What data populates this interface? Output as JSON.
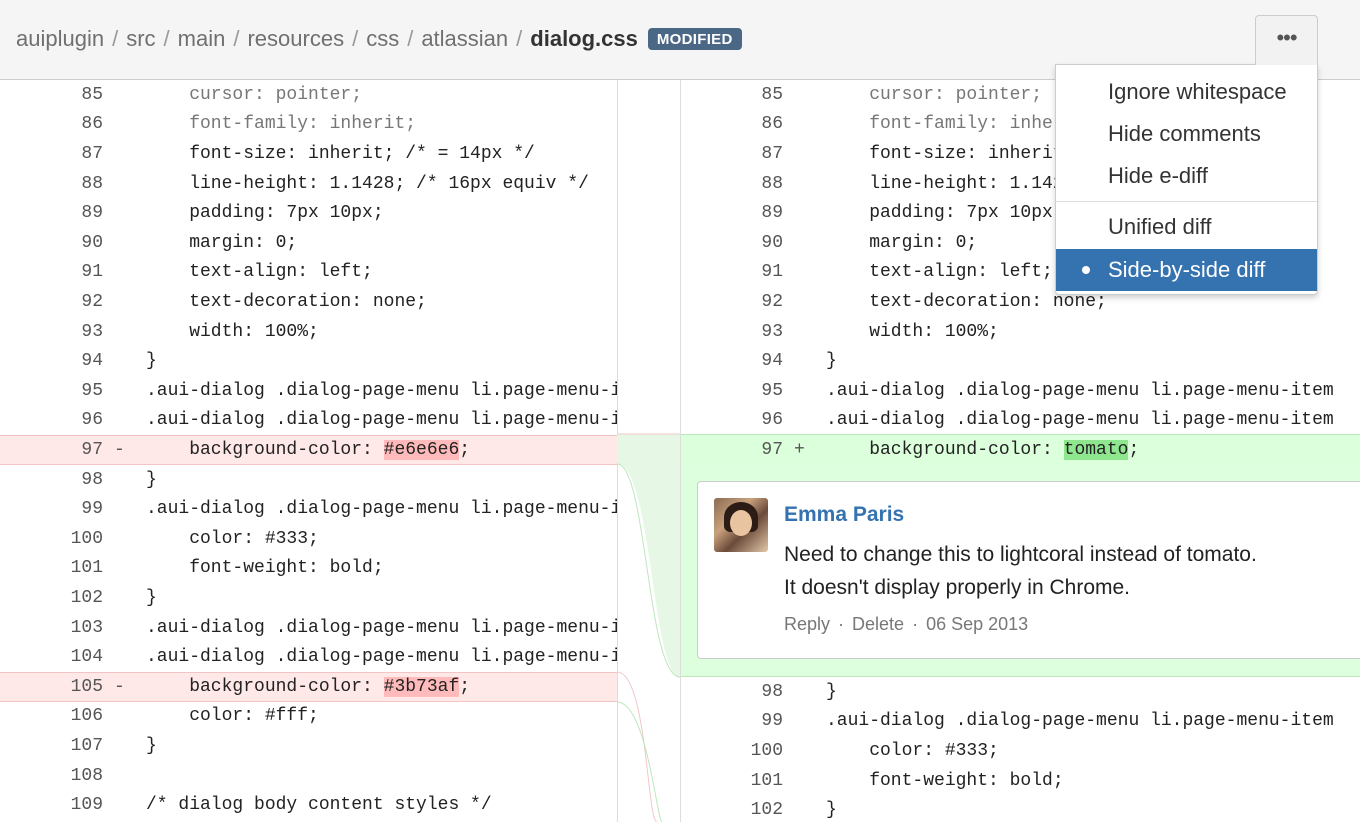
{
  "breadcrumb": {
    "parts": [
      "auiplugin",
      "src",
      "main",
      "resources",
      "css",
      "atlassian"
    ],
    "separator": "/",
    "file": "dialog.css",
    "badge": "MODIFIED"
  },
  "more_button": {
    "label": "•••"
  },
  "dropdown": {
    "items": [
      "Ignore whitespace",
      "Hide comments",
      "Hide e-diff"
    ],
    "view_items": [
      "Unified diff",
      "Side-by-side diff"
    ],
    "active": "Side-by-side diff"
  },
  "left_lines": [
    {
      "num": "85",
      "mark": "",
      "code": "    cursor: pointer;",
      "type": "ctx"
    },
    {
      "num": "86",
      "mark": "",
      "code": "    font-family: inherit;",
      "type": "ctx"
    },
    {
      "num": "87",
      "mark": "",
      "code": "    font-size: inherit; /* = 14px */",
      "type": "normal"
    },
    {
      "num": "88",
      "mark": "",
      "code": "    line-height: 1.1428; /* 16px equiv */",
      "type": "normal"
    },
    {
      "num": "89",
      "mark": "",
      "code": "    padding: 7px 10px;",
      "type": "normal"
    },
    {
      "num": "90",
      "mark": "",
      "code": "    margin: 0;",
      "type": "normal"
    },
    {
      "num": "91",
      "mark": "",
      "code": "    text-align: left;",
      "type": "normal"
    },
    {
      "num": "92",
      "mark": "",
      "code": "    text-decoration: none;",
      "type": "normal"
    },
    {
      "num": "93",
      "mark": "",
      "code": "    width: 100%;",
      "type": "normal"
    },
    {
      "num": "94",
      "mark": "",
      "code": "}",
      "type": "normal"
    },
    {
      "num": "95",
      "mark": "",
      "code": ".aui-dialog .dialog-page-menu li.page-menu-item",
      "type": "normal"
    },
    {
      "num": "96",
      "mark": "",
      "code": ".aui-dialog .dialog-page-menu li.page-menu-item",
      "type": "normal"
    },
    {
      "num": "97",
      "mark": "-",
      "code_before": "    background-color: ",
      "highlight": "#e6e6e6",
      "code_after": ";",
      "type": "removed"
    },
    {
      "num": "98",
      "mark": "",
      "code": "}",
      "type": "normal"
    },
    {
      "num": "99",
      "mark": "",
      "code": ".aui-dialog .dialog-page-menu li.page-menu-item",
      "type": "normal"
    },
    {
      "num": "100",
      "mark": "",
      "code": "    color: #333;",
      "type": "normal"
    },
    {
      "num": "101",
      "mark": "",
      "code": "    font-weight: bold;",
      "type": "normal"
    },
    {
      "num": "102",
      "mark": "",
      "code": "}",
      "type": "normal"
    },
    {
      "num": "103",
      "mark": "",
      "code": ".aui-dialog .dialog-page-menu li.page-menu-item",
      "type": "normal"
    },
    {
      "num": "104",
      "mark": "",
      "code": ".aui-dialog .dialog-page-menu li.page-menu-item",
      "type": "normal"
    },
    {
      "num": "105",
      "mark": "-",
      "code_before": "    background-color: ",
      "highlight": "#3b73af",
      "code_after": ";",
      "type": "removed"
    },
    {
      "num": "106",
      "mark": "",
      "code": "    color: #fff;",
      "type": "normal"
    },
    {
      "num": "107",
      "mark": "",
      "code": "}",
      "type": "normal"
    },
    {
      "num": "108",
      "mark": "",
      "code": "",
      "type": "normal"
    },
    {
      "num": "109",
      "mark": "",
      "code": "/* dialog body content styles */",
      "type": "normal"
    }
  ],
  "right_lines_top": [
    {
      "num": "85",
      "code": "    cursor: pointer;",
      "type": "ctx"
    },
    {
      "num": "86",
      "code": "    font-family: inherit;",
      "type": "ctx"
    },
    {
      "num": "87",
      "code": "    font-size: inherit; /* = 14px */",
      "type": "normal"
    },
    {
      "num": "88",
      "code": "    line-height: 1.1428; /* 16px equiv */",
      "type": "normal"
    },
    {
      "num": "89",
      "code": "    padding: 7px 10px;",
      "type": "normal"
    },
    {
      "num": "90",
      "code": "    margin: 0;",
      "type": "normal"
    },
    {
      "num": "91",
      "code": "    text-align: left;",
      "type": "normal"
    },
    {
      "num": "92",
      "code": "    text-decoration: none;",
      "type": "normal"
    },
    {
      "num": "93",
      "code": "    width: 100%;",
      "type": "normal"
    },
    {
      "num": "94",
      "code": "}",
      "type": "normal"
    },
    {
      "num": "95",
      "code": ".aui-dialog .dialog-page-menu li.page-menu-item",
      "type": "normal"
    },
    {
      "num": "96",
      "code": ".aui-dialog .dialog-page-menu li.page-menu-item",
      "type": "normal"
    }
  ],
  "right_added": {
    "num": "97",
    "mark": "+",
    "code_before": "    background-color: ",
    "highlight": "tomato",
    "code_after": ";"
  },
  "right_lines_bottom": [
    {
      "num": "98",
      "code": "}"
    },
    {
      "num": "99",
      "code": ".aui-dialog .dialog-page-menu li.page-menu-item"
    },
    {
      "num": "100",
      "code": "    color: #333;"
    },
    {
      "num": "101",
      "code": "    font-weight: bold;"
    },
    {
      "num": "102",
      "code": "}"
    }
  ],
  "comment": {
    "author": "Emma Paris",
    "text": "Need to change this to lightcoral instead of tomato.\nIt doesn't display properly in Chrome.",
    "actions": [
      "Reply",
      "Delete"
    ],
    "date": "06 Sep 2013"
  },
  "colors": {
    "removed_bg": "#ffe8e8",
    "removed_highlight": "#ffbbbb",
    "added_bg": "#ddffdd",
    "added_highlight": "#8ee68e",
    "accent": "#3572b0",
    "badge": "#4a6785"
  }
}
